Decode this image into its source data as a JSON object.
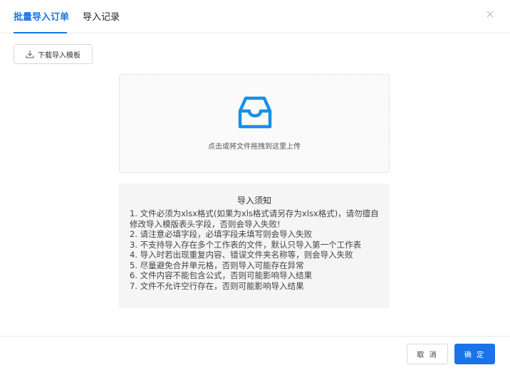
{
  "tabs": {
    "import": "批量导入订单",
    "record": "导入记录"
  },
  "toolbar": {
    "download_label": "下载导入模板"
  },
  "upload": {
    "hint": "点击或将文件拖拽到这里上传"
  },
  "notes": {
    "title": "导入须知",
    "items": [
      "1. 文件必须为xlsx格式(如果为xls格式请另存为xlsx格式)，请勿擅自修改导入模版表头字段，否则会导入失败!",
      "2. 请注意必填字段，必填字段未填写则会导入失败",
      "3. 不支持导入存在多个工作表的文件，默认只导入第一个工作表",
      "4. 导入时若出现重复内容、错误文件夹名称等，则会导入失败",
      "5. 尽量避免合并单元格，否则导入可能存在异常",
      "6. 文件内容不能包含公式，否则可能影响导入结果",
      "7. 文件不允许空行存在，否则可能影响导入结果"
    ]
  },
  "footer": {
    "cancel_label": "取 消",
    "ok_label": "确 定"
  },
  "colors": {
    "accent": "#1a73e8",
    "border": "#d9d9d9",
    "notes_bg": "#f5f5f5"
  },
  "icons": {
    "close": "close-icon",
    "download": "download-icon",
    "upload": "inbox-icon"
  }
}
